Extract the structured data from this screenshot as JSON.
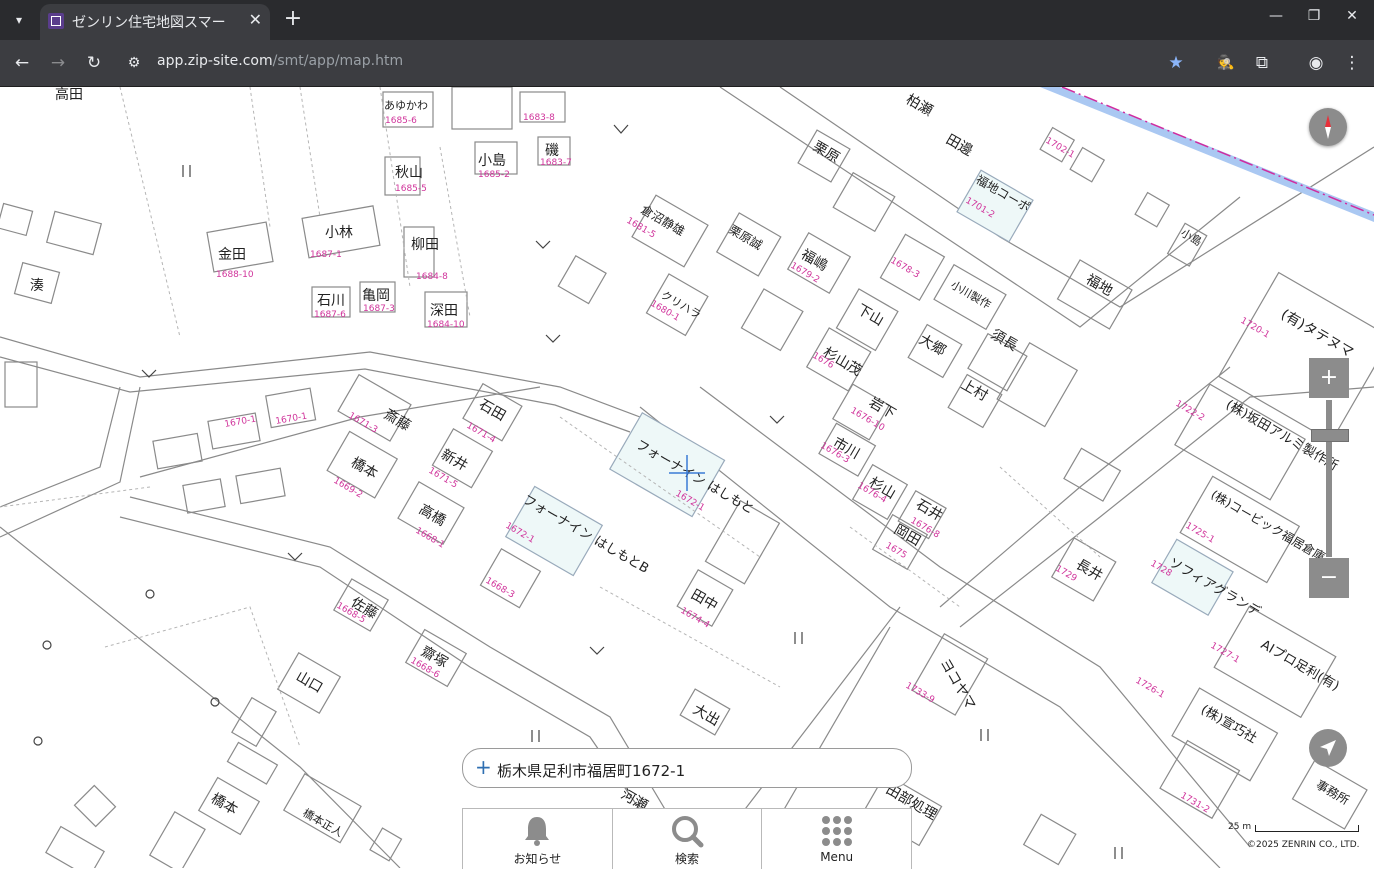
{
  "browser": {
    "tab_title": "ゼンリン住宅地図スマー",
    "url_host": "app.zip-site.com",
    "url_path": "/smt/app/map.htm",
    "tab_list_icon": "chevron-down-icon",
    "new_tab_icon": "plus-icon"
  },
  "map": {
    "labels": {
      "asahi": "あゆかわ",
      "kobayashi": "小林",
      "kaneda": "金田",
      "akiyama": "秋山",
      "kojima": "小島",
      "iso": "磯",
      "yanagida": "柳田",
      "ishikawa": "石川",
      "kameoka": "亀岡",
      "fukata": "深田",
      "minato": "湊",
      "takada": "高田",
      "saito": "斎藤",
      "ishida": "石田",
      "arai": "新井",
      "hashimoto": "橋本",
      "takahashi": "高橋",
      "foraine1": "フォーナイン はしもと",
      "foraine2": "フォーナイン はしもとB",
      "sato": "佐藤",
      "saikyo": "齋塚",
      "yamaguchi": "山口",
      "hashimoto2": "橋本",
      "hashimoto_masato": "橋本正人",
      "kurahara": "クリハラ",
      "kuranuma": "倉沼静雄",
      "kurihara_sei": "栗原誠",
      "fukushima": "福嶋",
      "shimoyama": "下山",
      "sugiyama_shige": "杉山茂",
      "iwashita": "岩下",
      "ichikawa": "市川",
      "sugiyama": "杉山",
      "ishii": "石井",
      "okada": "岡田",
      "tanaka": "田中",
      "oide": "大出",
      "kurihara": "栗原",
      "kashiwase": "柏瀬",
      "tabe": "田邊",
      "fukuchi_copo": "福地コーポ",
      "ogawa": "小川製作",
      "sunaga": "須長",
      "osato": "大郷",
      "kamimura": "上村",
      "fukuchi": "福地",
      "kojima2": "小島",
      "tatenuma": "(有)タテヌマ",
      "sakata_alumi": "(株)坂田アルミ製作所",
      "cubic": "(株)コービック福居倉庫",
      "sophia": "ソフィアグランデ",
      "nagai": "長井",
      "aipro": "AIプロ足利(有)",
      "hoshino": "(株)宣巧社",
      "yokoyama": "ヨコヤマ",
      "kawase": "河瀬",
      "tabe_shori": "田部処理",
      "jimusho": "事務所"
    },
    "parcel_numbers": [
      "1685-6",
      "1683-8",
      "1683-7",
      "1685-5",
      "1685-2",
      "1687-1",
      "1688-10",
      "1684-8",
      "1687-6",
      "1687-3",
      "1684-10",
      "1671-3",
      "1671-4",
      "1670-1",
      "1670-1",
      "1671-5",
      "1669-2",
      "1668-1",
      "1672-1",
      "1672-1",
      "1668-3",
      "1668-5",
      "1668-6",
      "1681-5",
      "1680-1",
      "1679-2",
      "1678-3",
      "1676",
      "1676-10",
      "1676-3",
      "1676-4",
      "1676-8",
      "1675",
      "1674-4",
      "1720-1",
      "1722-2",
      "1725-1",
      "1728",
      "1729",
      "1727-1",
      "1726-1",
      "1701-2",
      "1702-1",
      "1731-2",
      "1733-9"
    ]
  },
  "controls": {
    "compass_icon": "compass-icon",
    "zoom_in_label": "+",
    "zoom_out_label": "−",
    "zoom_level": 0.83,
    "locate_icon": "navigation-arrow-icon"
  },
  "search": {
    "plus_label": "+",
    "address": "栃木県足利市福居町1672-1"
  },
  "bottom_menu": {
    "items": [
      {
        "label": "お知らせ",
        "icon": "bell-icon"
      },
      {
        "label": "検索",
        "icon": "search-icon"
      },
      {
        "label": "Menu",
        "icon": "grid-icon"
      }
    ]
  },
  "scale": {
    "label": "25 m"
  },
  "copyright": "©2025 ZENRIN CO., LTD."
}
